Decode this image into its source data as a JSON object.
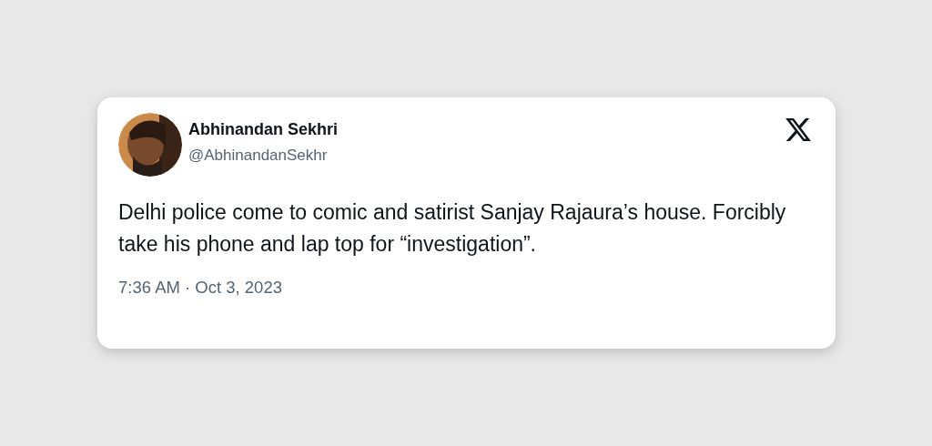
{
  "tweet": {
    "author": {
      "name": "Abhinandan Sekhri",
      "handle": "@AbhinandanSekhr"
    },
    "text": "Delhi police come to comic and satirist Sanjay Rajaura’s house. Forcibly take his phone and lap top for “investigation”.",
    "timestamp": "7:36 AM · Oct 3, 2023"
  }
}
